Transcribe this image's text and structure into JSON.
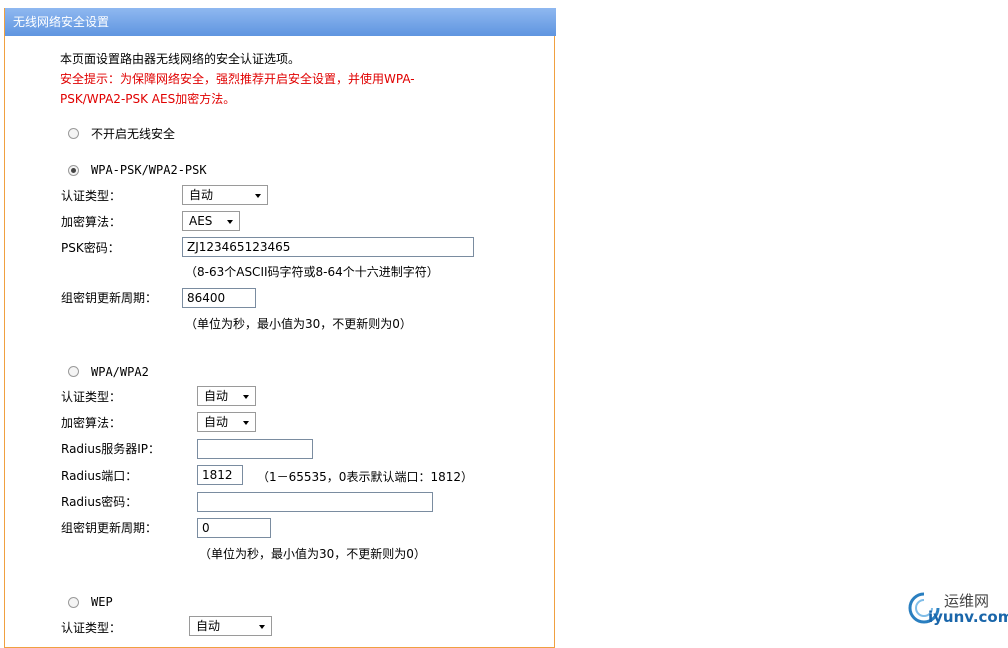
{
  "title": "无线网络安全设置",
  "intro": {
    "description": "本页面设置路由器无线网络的安全认证选项。",
    "warning_line1": "安全提示：为保障网络安全，强烈推荐开启安全设置，并使用WPA-",
    "warning_line2": "PSK/WPA2-PSK AES加密方法。"
  },
  "option_none": {
    "label": "不开启无线安全",
    "selected": false
  },
  "wpa_psk": {
    "label": "WPA-PSK/WPA2-PSK",
    "selected": true,
    "auth_type_label": "认证类型：",
    "auth_type_value": "自动",
    "encryption_label": "加密算法：",
    "encryption_value": "AES",
    "psk_label": "PSK密码：",
    "psk_value": "ZJ123465123465",
    "psk_hint": "（8-63个ASCII码字符或8-64个十六进制字符）",
    "group_key_label": "组密钥更新周期：",
    "group_key_value": "86400",
    "group_key_hint": "（单位为秒，最小值为30，不更新则为0）"
  },
  "wpa": {
    "label": "WPA/WPA2",
    "selected": false,
    "auth_type_label": "认证类型：",
    "auth_type_value": "自动",
    "encryption_label": "加密算法：",
    "encryption_value": "自动",
    "radius_ip_label": "Radius服务器IP：",
    "radius_ip_value": "",
    "radius_port_label": "Radius端口：",
    "radius_port_value": "1812",
    "radius_port_hint": "（1－65535，0表示默认端口：1812）",
    "radius_pwd_label": "Radius密码：",
    "radius_pwd_value": "",
    "group_key_label": "组密钥更新周期：",
    "group_key_value": "0",
    "group_key_hint": "（单位为秒，最小值为30，不更新则为0）"
  },
  "wep": {
    "label": "WEP",
    "selected": false,
    "auth_type_label": "认证类型：",
    "auth_type_value": "自动"
  },
  "watermark": {
    "cn": "运维网",
    "en": "iyunv.com"
  },
  "colors": {
    "title_bar": "#6a9de4",
    "panel_border": "#f0a040",
    "warning": "#e00000"
  }
}
